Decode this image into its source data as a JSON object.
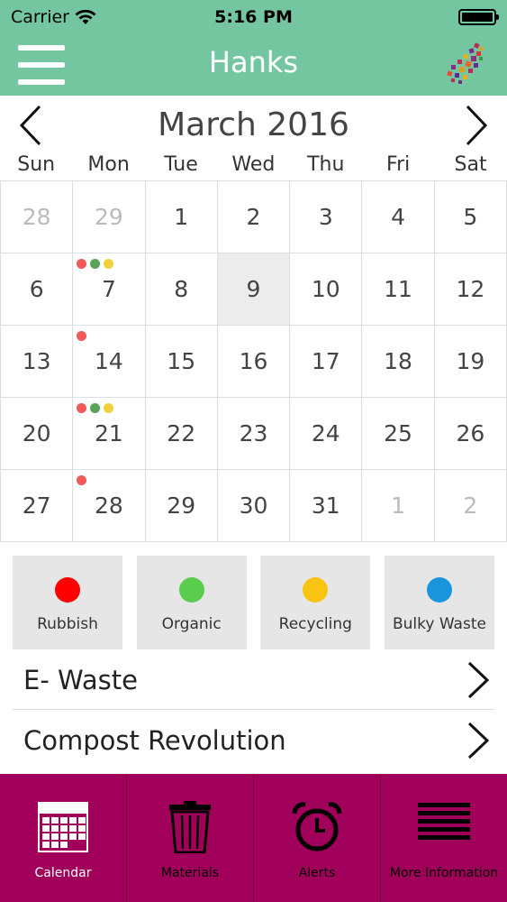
{
  "status": {
    "carrier": "Carrier",
    "time": "5:16 PM"
  },
  "nav": {
    "title": "Hanks"
  },
  "calendar": {
    "month_title": "March 2016",
    "weekdays": [
      "Sun",
      "Mon",
      "Tue",
      "Wed",
      "Thu",
      "Fri",
      "Sat"
    ],
    "days": [
      {
        "label": "28",
        "muted": true
      },
      {
        "label": "29",
        "muted": true
      },
      {
        "label": "1"
      },
      {
        "label": "2"
      },
      {
        "label": "3"
      },
      {
        "label": "4"
      },
      {
        "label": "5"
      },
      {
        "label": "6"
      },
      {
        "label": "7",
        "dots": [
          "#f05a5a",
          "#5aa35a",
          "#f2d03b"
        ]
      },
      {
        "label": "8"
      },
      {
        "label": "9",
        "today": true
      },
      {
        "label": "10"
      },
      {
        "label": "11"
      },
      {
        "label": "12"
      },
      {
        "label": "13"
      },
      {
        "label": "14",
        "dots": [
          "#f05a5a"
        ]
      },
      {
        "label": "15"
      },
      {
        "label": "16"
      },
      {
        "label": "17"
      },
      {
        "label": "18"
      },
      {
        "label": "19"
      },
      {
        "label": "20"
      },
      {
        "label": "21",
        "dots": [
          "#f05a5a",
          "#5aa35a",
          "#f2d03b"
        ]
      },
      {
        "label": "22"
      },
      {
        "label": "23"
      },
      {
        "label": "24"
      },
      {
        "label": "25"
      },
      {
        "label": "26"
      },
      {
        "label": "27"
      },
      {
        "label": "28",
        "dots": [
          "#f05a5a"
        ]
      },
      {
        "label": "29"
      },
      {
        "label": "30"
      },
      {
        "label": "31"
      },
      {
        "label": "1",
        "muted": true
      },
      {
        "label": "2",
        "muted": true
      }
    ]
  },
  "legend": [
    {
      "label": "Rubbish",
      "color": "#ff0000"
    },
    {
      "label": "Organic",
      "color": "#5acd4f"
    },
    {
      "label": "Recycling",
      "color": "#f8c411"
    },
    {
      "label": "Bulky Waste",
      "color": "#1a95dc"
    }
  ],
  "links": [
    {
      "label": "E- Waste"
    },
    {
      "label": "Compost Revolution"
    }
  ],
  "tabs": [
    {
      "label": "Calendar",
      "icon": "calendar-icon"
    },
    {
      "label": "Materials",
      "icon": "trash-icon"
    },
    {
      "label": "Alerts",
      "icon": "alarm-clock-icon"
    },
    {
      "label": "More Information",
      "icon": "menu-lines-icon"
    }
  ],
  "colors": {
    "header": "#74c6a0",
    "tab_bar": "#a0005a"
  }
}
